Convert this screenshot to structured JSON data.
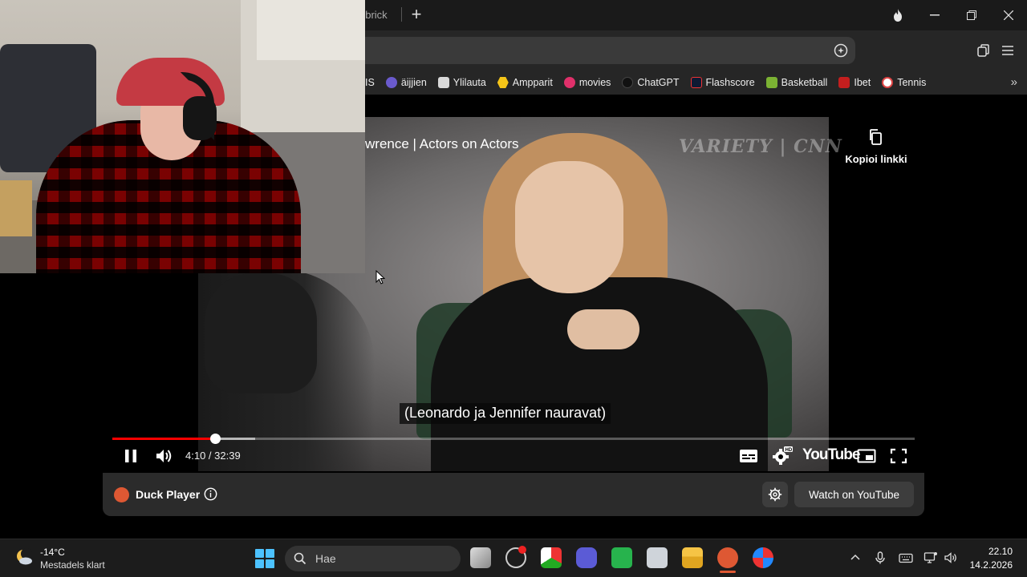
{
  "browser": {
    "tab_fragment": "ubrick",
    "new_tab": "+",
    "bookmarks": [
      {
        "label": "IS",
        "color": "#262626"
      },
      {
        "label": "äijjien",
        "color": "#6a5acd"
      },
      {
        "label": "Ylilauta",
        "color": "#d9d9d9"
      },
      {
        "label": "Ampparit",
        "color": "#f5c518"
      },
      {
        "label": "movies",
        "color": "#e0306a"
      },
      {
        "label": "ChatGPT",
        "color": "#1a1a1a"
      },
      {
        "label": "Flashscore",
        "color": "#0e1a33"
      },
      {
        "label": "Basketball",
        "color": "#7bb233"
      },
      {
        "label": "Ibet",
        "color": "#c41e1e"
      },
      {
        "label": "Tennis",
        "color": "#ffffff"
      }
    ]
  },
  "player": {
    "video_title": "wrence | Actors on Actors",
    "watermark": "VARIETY | CNN",
    "subtitle": "(Leonardo ja Jennifer nauravat)",
    "time_display": "4:10 / 32:39",
    "progress_fraction": 0.128,
    "buffered_fraction": 0.178,
    "youtube_word": "YouTube",
    "copy_link_label": "Kopioi linkki"
  },
  "duck_player": {
    "label": "Duck Player",
    "watch_button": "Watch on YouTube"
  },
  "taskbar": {
    "weather_temp": "-14°C",
    "weather_desc": "Mestadels klart",
    "search_placeholder": "Hae",
    "time": "22.10",
    "date": "14.2.2026"
  },
  "colors": {
    "progress": "#ff0000",
    "duck_accent": "#de5833",
    "windows_accent": "#4cc2ff"
  }
}
